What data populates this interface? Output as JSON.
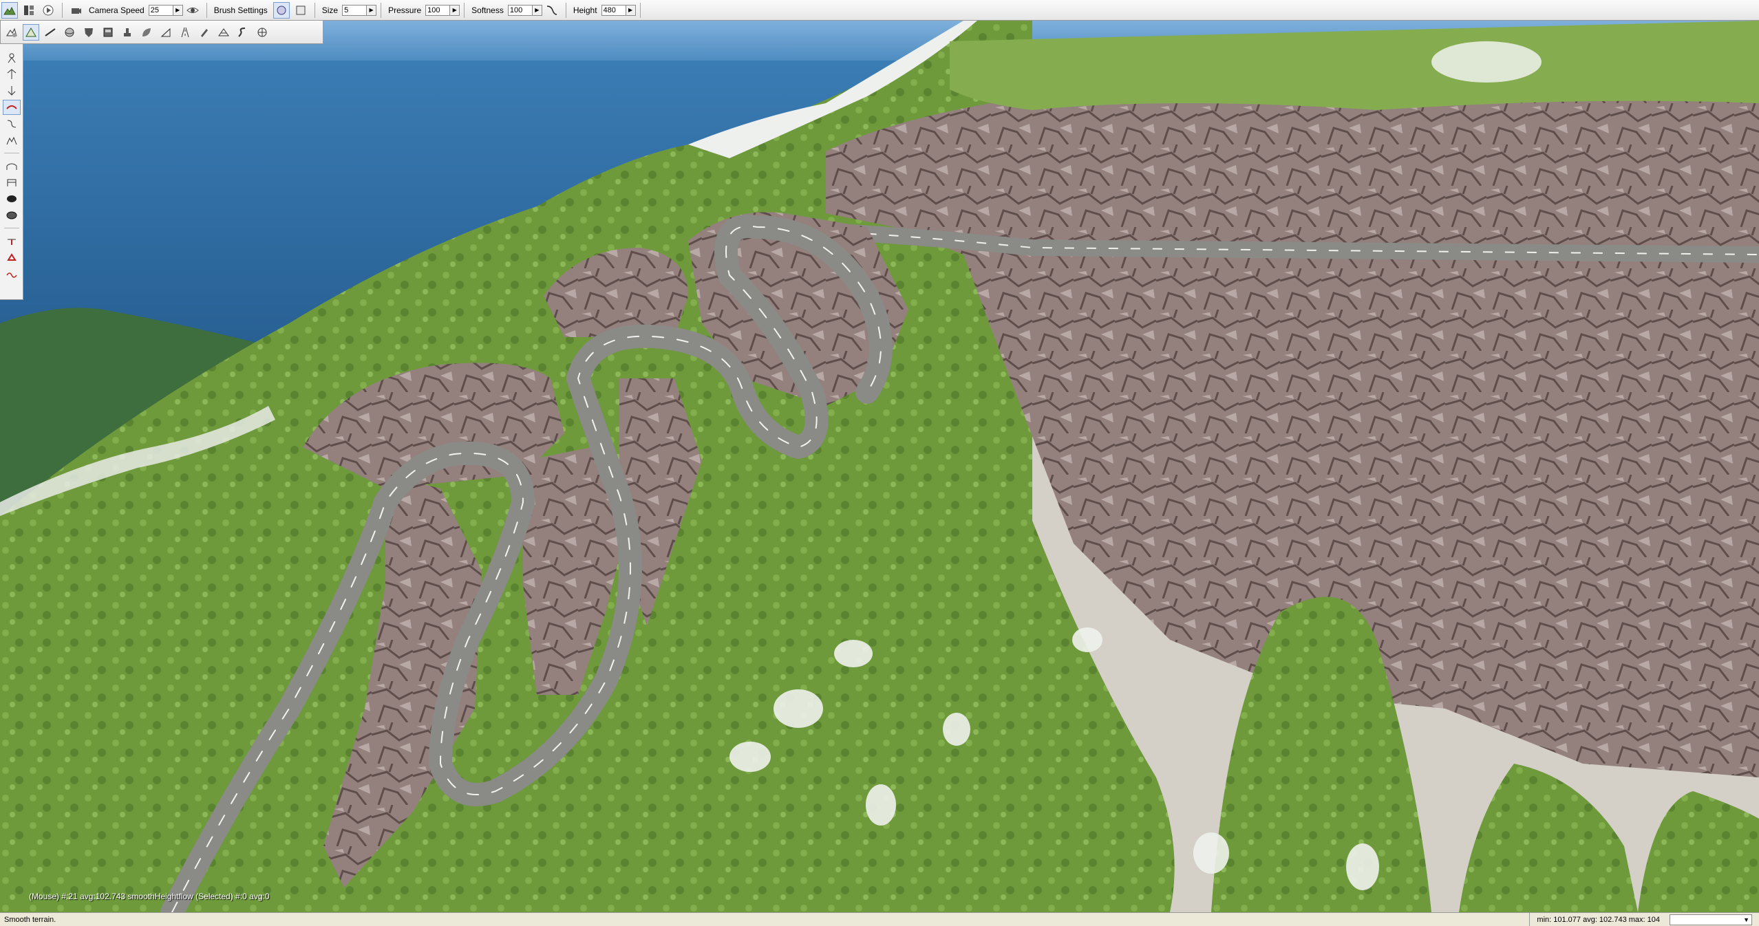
{
  "toolbar": {
    "camera_speed_label": "Camera Speed",
    "camera_speed_value": "25",
    "brush_settings_label": "Brush Settings",
    "size_label": "Size",
    "size_value": "5",
    "pressure_label": "Pressure",
    "pressure_value": "100",
    "softness_label": "Softness",
    "softness_value": "100",
    "height_label": "Height",
    "height_value": "480"
  },
  "icons": {
    "top": [
      "terrain-editor-icon",
      "layout-icon",
      "play-icon",
      "camera-icon",
      "visibility-eye-icon",
      "brush-circle-icon",
      "brush-square-icon",
      "softness-curve-icon"
    ],
    "second_row": [
      "terrain-settings-icon",
      "raise-terrain-icon",
      "flatten-icon",
      "smooth-sphere-icon",
      "shield-icon",
      "material-icon",
      "stamp-icon",
      "leaf-icon",
      "slope-icon",
      "road-icon",
      "paint-icon",
      "mesh-icon",
      "river-icon",
      "decal-icon"
    ],
    "left": [
      "select-object-icon",
      "move-icon",
      "rotate-icon",
      "road-tool-icon",
      "spline-icon",
      "mountain-icon",
      "bridge-icon",
      "gate-icon",
      "oval-dark-icon",
      "oval-fill-icon",
      "marker-add-icon",
      "marker-remove-icon",
      "path-icon"
    ]
  },
  "viewport": {
    "overlay_text": "(Mouse) #:21  avg:102.743 smoothHeightflow  (Selected) #:0  avg:0"
  },
  "statusbar": {
    "message": "Smooth terrain.",
    "stats": "min: 101.077  avg: 102.743  max: 104"
  },
  "colors": {
    "sky": "#3e78b0",
    "sea": "#2f6595",
    "grass": "#6f9c3a",
    "rock": "#8f7b78",
    "road": "#8a8a86"
  }
}
